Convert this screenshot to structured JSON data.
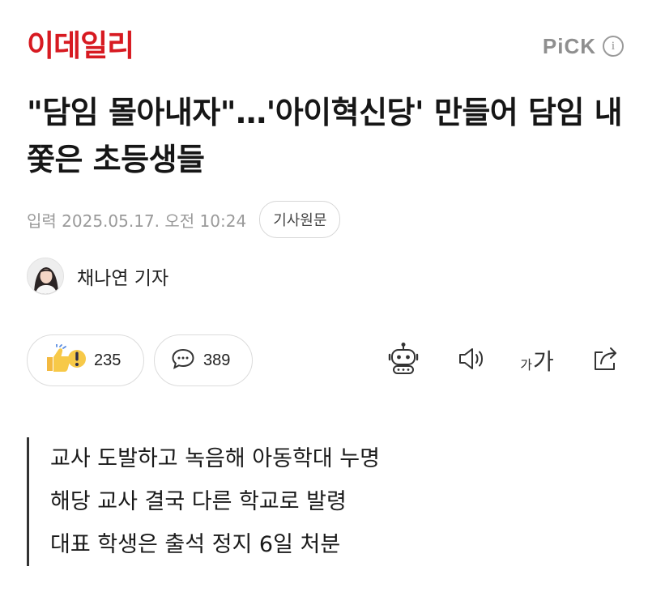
{
  "header": {
    "logo": "이데일리",
    "pick_label": "PiCK",
    "info_glyph": "i"
  },
  "article": {
    "title": "\"담임 몰아내자\"…'아이혁신당' 만들어 담임 내쫓은 초등생들",
    "date": "입력 2025.05.17. 오전 10:24",
    "original_button": "기사원문",
    "reporter": "채나연 기자"
  },
  "actions": {
    "reaction_count": "235",
    "comment_count": "389",
    "font_size_small": "가",
    "font_size_large": "가"
  },
  "summary": [
    "교사 도발하고 녹음해 아동학대 누명",
    "해당 교사 결국 다른 학교로 발령",
    "대표 학생은 출석 정지 6일 처분"
  ],
  "icons": {
    "reaction": "thumbs-up-surprise-icon",
    "comment": "speech-bubble-icon",
    "ai": "robot-icon",
    "tts": "speaker-icon",
    "font": "font-size-icon",
    "share": "share-icon"
  },
  "colors": {
    "brand": "#d71a21",
    "muted": "#9a9a9a",
    "text": "#161616"
  }
}
